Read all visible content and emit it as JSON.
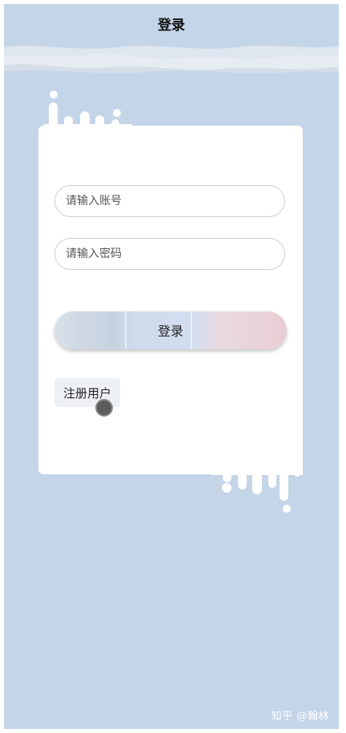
{
  "header": {
    "title": "登录"
  },
  "form": {
    "account_placeholder": "请输入账号",
    "password_placeholder": "请输入密码",
    "login_label": "登录",
    "register_label": "注册用户"
  },
  "watermark": "知乎 @翰林",
  "colors": {
    "background": "#c5d5e8",
    "card": "#ffffff"
  }
}
